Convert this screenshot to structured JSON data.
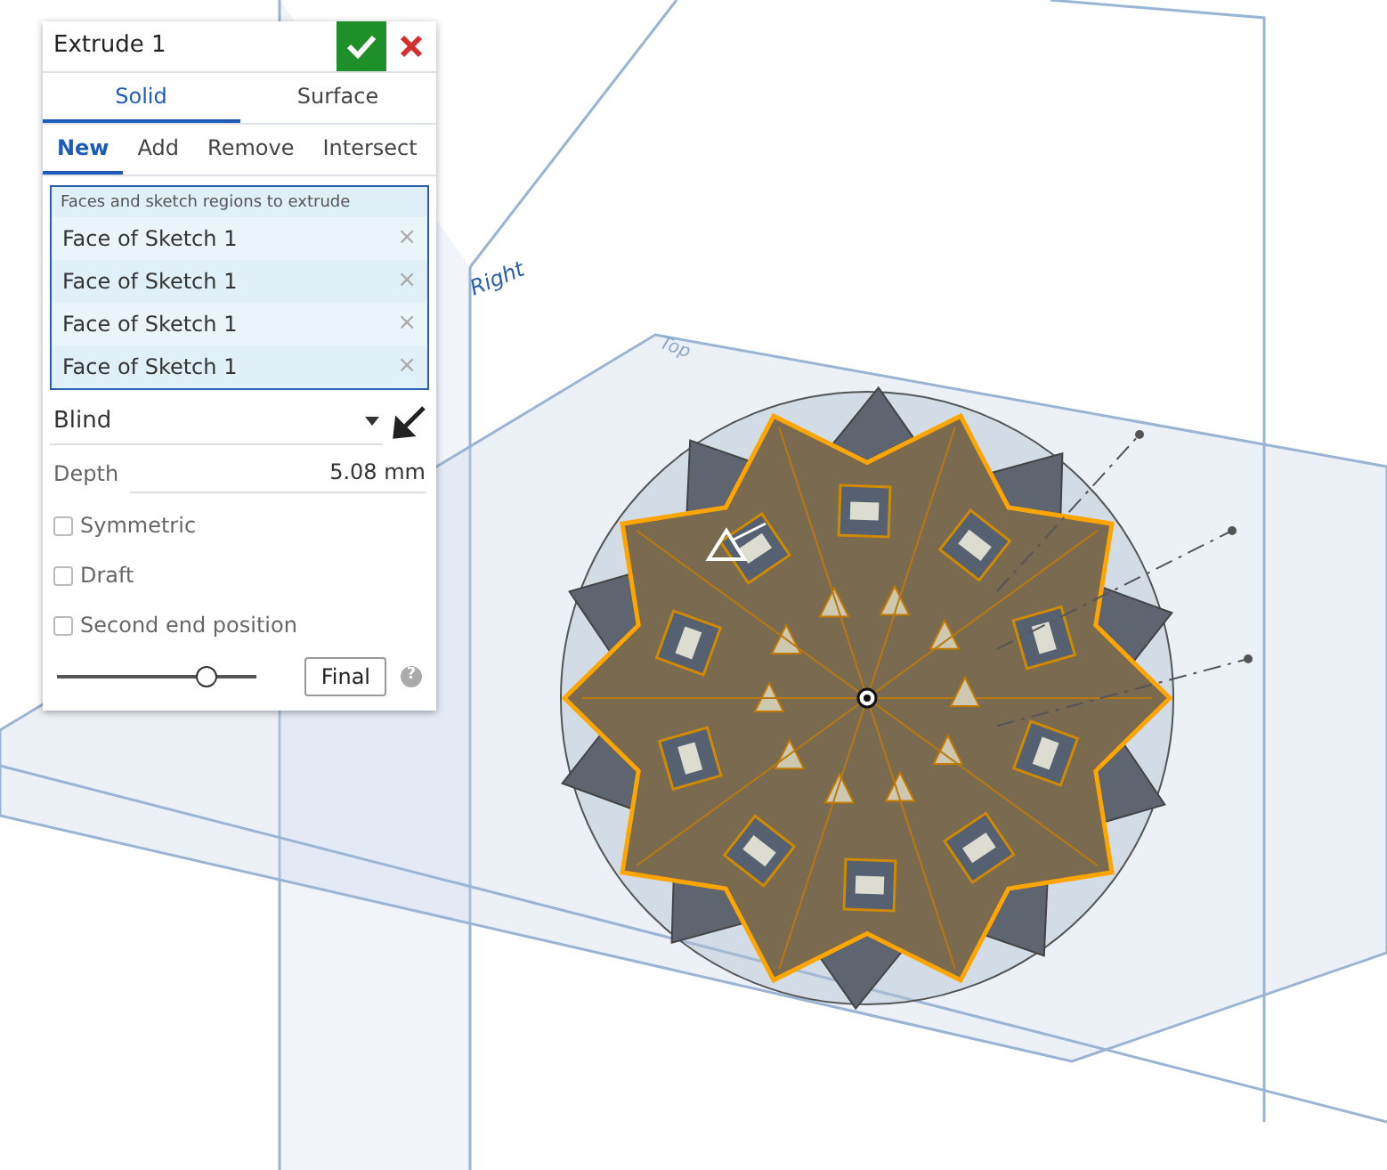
{
  "viewport": {
    "planes": [
      {
        "label": "Right"
      },
      {
        "label": "Top"
      }
    ]
  },
  "dialog": {
    "title": "Extrude 1",
    "body_types": [
      {
        "label": "Solid",
        "selected": true
      },
      {
        "label": "Surface",
        "selected": false
      }
    ],
    "operations": [
      {
        "label": "New",
        "selected": true
      },
      {
        "label": "Add",
        "selected": false
      },
      {
        "label": "Remove",
        "selected": false
      },
      {
        "label": "Intersect",
        "selected": false
      }
    ],
    "selection": {
      "heading": "Faces and sketch regions to extrude",
      "items": [
        {
          "label": "Face of Sketch 1",
          "remove": "×"
        },
        {
          "label": "Face of Sketch 1",
          "remove": "×"
        },
        {
          "label": "Face of Sketch 1",
          "remove": "×"
        },
        {
          "label": "Face of Sketch 1",
          "remove": "×"
        }
      ]
    },
    "end_type": "Blind",
    "depth": {
      "label": "Depth",
      "value": "5.08 mm"
    },
    "options": [
      {
        "label": "Symmetric",
        "checked": false
      },
      {
        "label": "Draft",
        "checked": false
      },
      {
        "label": "Second end position",
        "checked": false
      }
    ],
    "preview": {
      "level": 0.75,
      "button": "Final",
      "help": "?"
    }
  }
}
